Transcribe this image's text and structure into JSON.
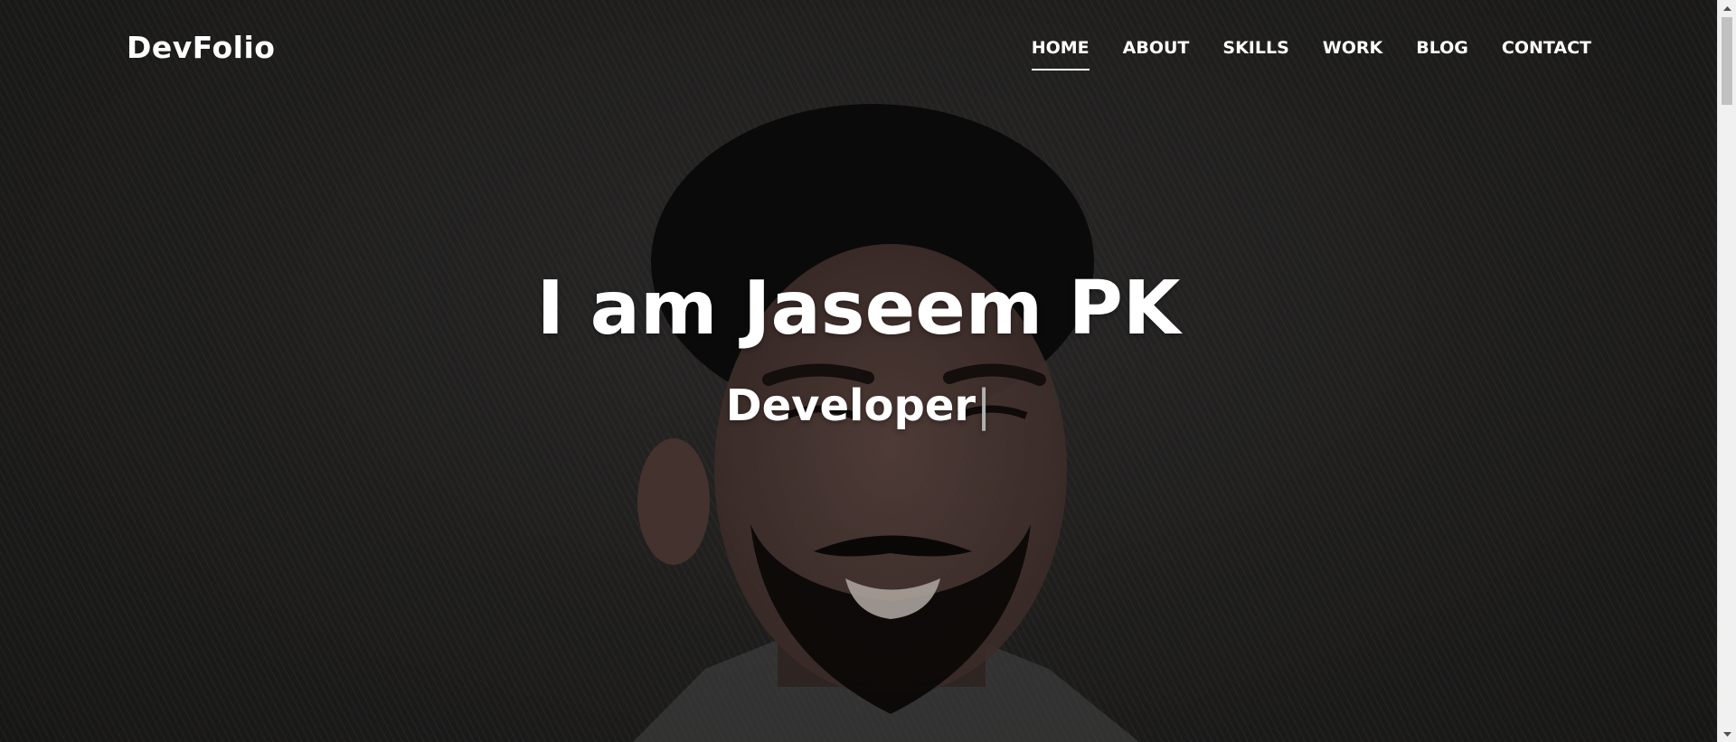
{
  "navbar": {
    "brand": "DevFolio",
    "items": [
      {
        "label": "HOME",
        "active": true
      },
      {
        "label": "ABOUT",
        "active": false
      },
      {
        "label": "SKILLS",
        "active": false
      },
      {
        "label": "WORK",
        "active": false
      },
      {
        "label": "BLOG",
        "active": false
      },
      {
        "label": "CONTACT",
        "active": false
      }
    ]
  },
  "hero": {
    "title": "I am Jaseem PK",
    "subtitle": "Developer",
    "cursor": "|"
  },
  "colors": {
    "text": "#ffffff",
    "cursor": "#b0b0b0",
    "background": "#262524"
  }
}
